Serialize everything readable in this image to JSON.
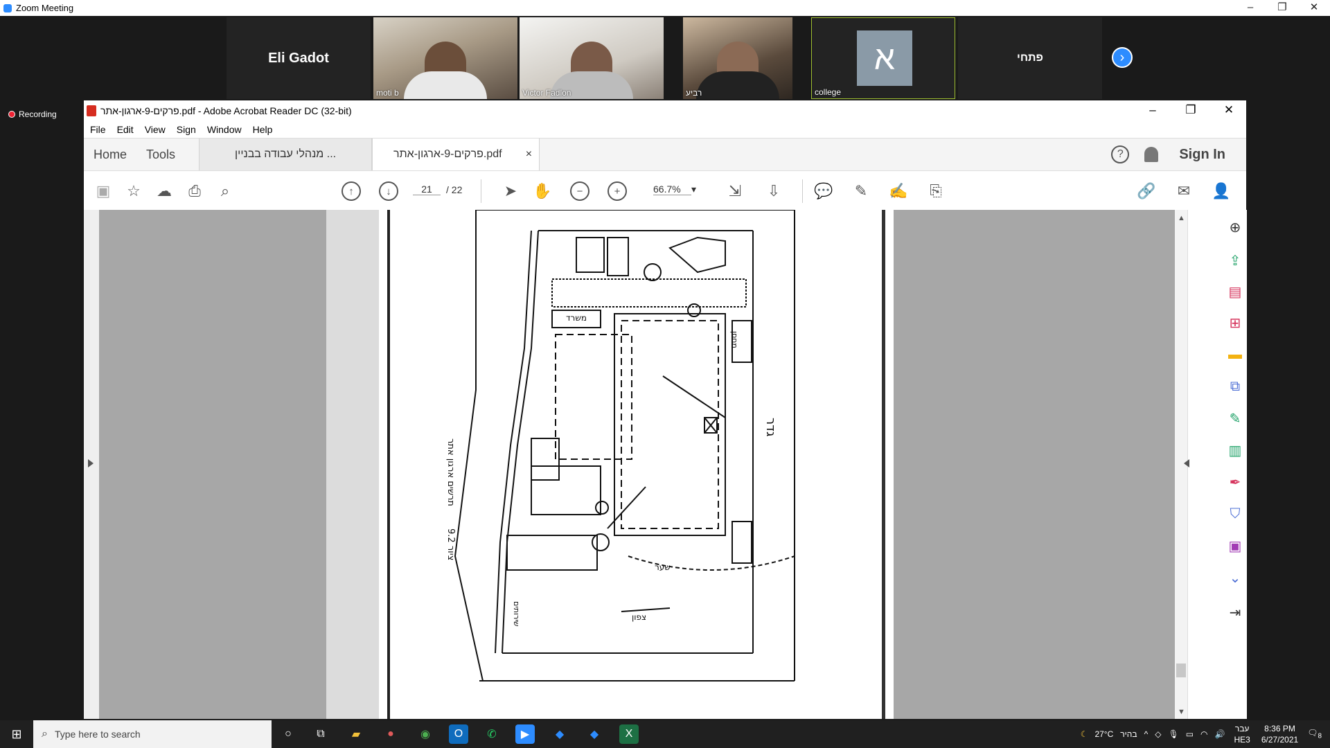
{
  "zoom": {
    "title": "Zoom Meeting",
    "participants": [
      {
        "name": "Eli Gadot",
        "type": "name"
      },
      {
        "name": "moti b",
        "type": "video"
      },
      {
        "name": "Victor Fadlon",
        "type": "video"
      },
      {
        "name": "רביע",
        "type": "video"
      },
      {
        "name": "college",
        "type": "avatar",
        "initial": "א"
      },
      {
        "name": "פתחי",
        "type": "name"
      }
    ],
    "recording_label": "Recording",
    "next_icon": "chevron-right-icon"
  },
  "acrobat": {
    "title": "פרקים-9-ארגון-אתר.pdf - Adobe Acrobat Reader DC (32-bit)",
    "menu": [
      "File",
      "Edit",
      "View",
      "Sign",
      "Window",
      "Help"
    ],
    "tabs": {
      "home": "Home",
      "tools": "Tools",
      "doc1": "מנהלי עבודה בבניין ...",
      "doc2": "פרקים-9-ארגון-אתר.pdf",
      "close": "×"
    },
    "sign_in": "Sign In",
    "help_glyph": "?",
    "page_current": "21",
    "page_total": "/ 22",
    "zoom_value": "66.7%",
    "zoom_caret": "▾"
  },
  "plan_labels": {
    "side_title": "תרשים ארגון אתר",
    "wall": "גדר",
    "office": "משרד",
    "storage": "מחסן",
    "toilets": "שירותים",
    "north": "צפון",
    "gate": "שער",
    "fig": "9.2 ציור"
  },
  "taskbar": {
    "search_placeholder": "Type here to search",
    "weather": "27°C",
    "weather_text": "בהיר",
    "lang": "עבר",
    "lang2": "HE3",
    "time": "8:36 PM",
    "date": "6/27/2021",
    "notif_count": "8"
  },
  "colors": {
    "zoom_blue": "#2d8cff",
    "acrobat_red": "#d62d20",
    "record_red": "#e23333"
  }
}
